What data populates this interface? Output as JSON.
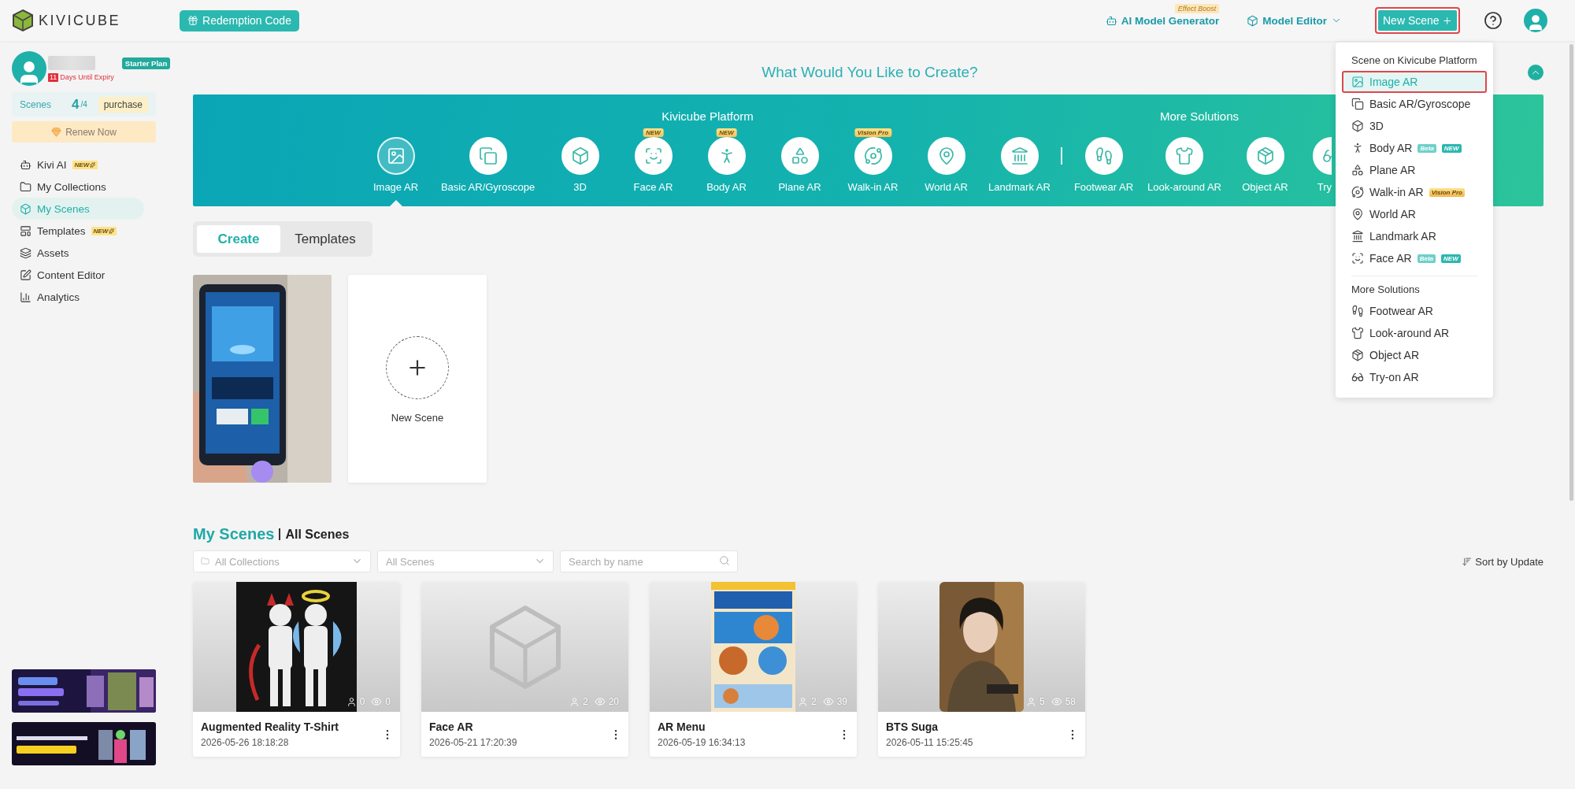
{
  "top_bar": {
    "logo": "KIVICUBE",
    "redemption_button": "Redemption Code",
    "ai_generator": {
      "label": "AI Model Generator",
      "badge": "Effect Boost"
    },
    "model_editor": "Model Editor",
    "new_scene_button": {
      "label": "New Scene",
      "outlined": true
    }
  },
  "sidebar": {
    "account": {
      "days_left": "11",
      "expiry_note": "Days Until Expiry",
      "plan": "Starter Plan"
    },
    "quota": {
      "label": "Scenes",
      "used": "4",
      "limit": "/4",
      "purchase": "purchase"
    },
    "renew_button": "Renew Now",
    "nav": [
      {
        "label": "Kivi AI",
        "badge": "NEW",
        "selected": false
      },
      {
        "label": "My Collections",
        "selected": false
      },
      {
        "label": "My Scenes",
        "selected": true
      },
      {
        "label": "Templates",
        "badge": "NEW",
        "selected": false
      },
      {
        "label": "Assets",
        "selected": false
      },
      {
        "label": "Content Editor",
        "selected": false
      },
      {
        "label": "Analytics",
        "selected": false
      }
    ],
    "ads": [
      {
        "kind": "picture"
      },
      {
        "kind": "picture"
      }
    ]
  },
  "create_panel": {
    "title": "What Would You Like to Create?",
    "expanded": true,
    "groups": [
      {
        "heading": "Kivicube Platform",
        "items": [
          {
            "label": "Image AR",
            "selected": true
          },
          {
            "label": "Basic AR/Gyroscope",
            "selected": false
          },
          {
            "label": "3D",
            "selected": false
          },
          {
            "label": "Face AR",
            "badge": "NEW",
            "selected": false
          },
          {
            "label": "Body AR",
            "badge": "NEW",
            "selected": false
          },
          {
            "label": "Plane AR",
            "selected": false
          },
          {
            "label": "Walk-in AR",
            "badge": "Vision Pro",
            "selected": false
          },
          {
            "label": "World AR",
            "selected": false
          },
          {
            "label": "Landmark AR",
            "selected": false
          }
        ]
      },
      {
        "heading": "More Solutions",
        "items": [
          {
            "label": "Footwear AR",
            "selected": false
          },
          {
            "label": "Look-around AR",
            "selected": false
          },
          {
            "label": "Object AR",
            "selected": false
          },
          {
            "label": "Try",
            "selected": false
          }
        ]
      }
    ],
    "tabs": [
      {
        "label": "Create",
        "selected": true
      },
      {
        "label": "Templates",
        "selected": false
      }
    ],
    "templates": [
      {
        "kind": "picture"
      },
      {
        "kind": "new",
        "label": "New Scene"
      }
    ]
  },
  "my_scenes": {
    "title": "My Scenes",
    "subtitle": "All Scenes",
    "filters": [
      {
        "kind": "select",
        "placeholder": "All Collections"
      },
      {
        "kind": "select",
        "placeholder": "All Scenes"
      },
      {
        "kind": "search",
        "placeholder": "Search by name"
      }
    ],
    "sort": "Sort by Update",
    "scenes": [
      {
        "title": "Augmented Reality T-Shirt",
        "date": "2026-05-26 18:18:28",
        "users": "0",
        "views": "0",
        "kind": "picture"
      },
      {
        "title": "Face AR",
        "date": "2026-05-21 17:20:39",
        "users": "2",
        "views": "20",
        "kind": "placeholder"
      },
      {
        "title": "AR Menu",
        "date": "2026-05-19 16:34:13",
        "users": "2",
        "views": "39",
        "kind": "picture"
      },
      {
        "title": "BTS Suga",
        "date": "2026-05-11 15:25:45",
        "users": "5",
        "views": "58",
        "kind": "picture"
      }
    ]
  },
  "new_scene_menu": {
    "sections": [
      {
        "heading": "Scene on Kivicube Platform",
        "items": [
          {
            "label": "Image AR",
            "selected": true,
            "outlined": true
          },
          {
            "label": "Basic AR/Gyroscope",
            "selected": false,
            "outlined": false
          },
          {
            "label": "3D",
            "selected": false,
            "outlined": false
          },
          {
            "label": "Body AR",
            "selected": false,
            "outlined": false,
            "tags": [
              {
                "label": "Beta",
                "kind": "beta"
              },
              {
                "label": "NEW",
                "kind": "new"
              }
            ]
          },
          {
            "label": "Plane AR",
            "selected": false,
            "outlined": false
          },
          {
            "label": "Walk-in AR",
            "selected": false,
            "outlined": false,
            "tags": [
              {
                "label": "Vision Pro",
                "kind": "vision"
              }
            ]
          },
          {
            "label": "World AR",
            "selected": false,
            "outlined": false
          },
          {
            "label": "Landmark AR",
            "selected": false,
            "outlined": false
          },
          {
            "label": "Face AR",
            "selected": false,
            "outlined": false,
            "tags": [
              {
                "label": "Beta",
                "kind": "beta"
              },
              {
                "label": "NEW",
                "kind": "new"
              }
            ]
          }
        ]
      },
      {
        "heading": "More Solutions",
        "items": [
          {
            "label": "Footwear AR",
            "selected": false,
            "outlined": false
          },
          {
            "label": "Look-around AR",
            "selected": false,
            "outlined": false
          },
          {
            "label": "Object AR",
            "selected": false,
            "outlined": false
          },
          {
            "label": "Try-on AR",
            "selected": false,
            "outlined": false
          }
        ]
      }
    ]
  }
}
